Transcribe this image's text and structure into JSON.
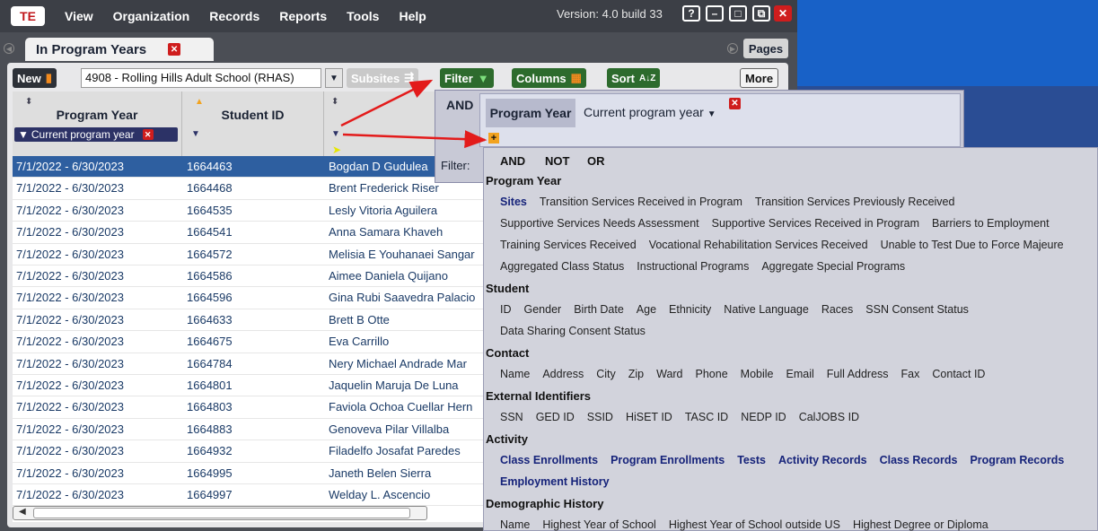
{
  "menu": {
    "logo": "TE",
    "items": [
      "View",
      "Organization",
      "Records",
      "Reports",
      "Tools",
      "Help"
    ],
    "version": "Version: 4.0 build 33",
    "window_buttons": [
      "?",
      "–",
      "□",
      "⧉",
      "✕"
    ]
  },
  "tab": {
    "label": "In Program Years",
    "close": "✕",
    "pages": "Pages"
  },
  "toolbar": {
    "new": "New",
    "school": "4908 - Rolling Hills Adult School (RHAS)",
    "subsites": "Subsites",
    "filter": "Filter",
    "columns": "Columns",
    "sort": "Sort",
    "sort_glyph": "A↓Z",
    "more": "More"
  },
  "grid": {
    "headers": [
      "Program Year",
      "Student ID",
      ""
    ],
    "filter_chip": "Current program year",
    "rows": [
      [
        "7/1/2022 - 6/30/2023",
        "1664463",
        "Bogdan D Gudulea"
      ],
      [
        "7/1/2022 - 6/30/2023",
        "1664468",
        "Brent Frederick Riser"
      ],
      [
        "7/1/2022 - 6/30/2023",
        "1664535",
        "Lesly Vitoria Aguilera"
      ],
      [
        "7/1/2022 - 6/30/2023",
        "1664541",
        "Anna Samara Khaveh"
      ],
      [
        "7/1/2022 - 6/30/2023",
        "1664572",
        "Melisia E Youhanaei Sangar"
      ],
      [
        "7/1/2022 - 6/30/2023",
        "1664586",
        "Aimee Daniela Quijano"
      ],
      [
        "7/1/2022 - 6/30/2023",
        "1664596",
        "Gina Rubi Saavedra Palacio"
      ],
      [
        "7/1/2022 - 6/30/2023",
        "1664633",
        "Brett B Otte"
      ],
      [
        "7/1/2022 - 6/30/2023",
        "1664675",
        "Eva Carrillo"
      ],
      [
        "7/1/2022 - 6/30/2023",
        "1664784",
        "Nery Michael Andrade Mar"
      ],
      [
        "7/1/2022 - 6/30/2023",
        "1664801",
        "Jaquelin Maruja De Luna"
      ],
      [
        "7/1/2022 - 6/30/2023",
        "1664803",
        "Faviola Ochoa Cuellar Hern"
      ],
      [
        "7/1/2022 - 6/30/2023",
        "1664883",
        "Genoveva Pilar Villalba"
      ],
      [
        "7/1/2022 - 6/30/2023",
        "1664932",
        "Filadelfo Josafat Paredes"
      ],
      [
        "7/1/2022 - 6/30/2023",
        "1664995",
        "Janeth Belen Sierra"
      ],
      [
        "7/1/2022 - 6/30/2023",
        "1664997",
        "Welday L. Ascencio"
      ]
    ]
  },
  "filter_panel": {
    "and": "AND",
    "chip": "Program Year",
    "value": "Current program year",
    "label": "Filter:"
  },
  "dropdown": {
    "ops": [
      "AND",
      "NOT",
      "OR"
    ],
    "sections": [
      {
        "title": "Program Year",
        "lines": [
          [
            "Sites",
            "Transition Services Received in Program",
            "Transition Services Previously Received"
          ],
          [
            "Supportive Services Needs Assessment",
            "Supportive Services Received in Program",
            "Barriers to Employment"
          ],
          [
            "Training Services Received",
            "Vocational Rehabilitation Services Received",
            "Unable to Test Due to Force Majeure"
          ],
          [
            "Aggregated Class Status",
            "Instructional Programs",
            "Aggregate Special Programs"
          ]
        ]
      },
      {
        "title": "Student",
        "lines": [
          [
            "ID",
            "Gender",
            "Birth Date",
            "Age",
            "Ethnicity",
            "Native Language",
            "Races",
            "SSN Consent Status"
          ],
          [
            "Data Sharing Consent Status"
          ]
        ]
      },
      {
        "title": "Contact",
        "lines": [
          [
            "Name",
            "Address",
            "City",
            "Zip",
            "Ward",
            "Phone",
            "Mobile",
            "Email",
            "Full Address",
            "Fax",
            "Contact ID"
          ]
        ]
      },
      {
        "title": "External Identifiers",
        "lines": [
          [
            "SSN",
            "GED ID",
            "SSID",
            "HiSET ID",
            "TASC ID",
            "NEDP ID",
            "CalJOBS ID"
          ]
        ]
      },
      {
        "title": "Activity",
        "lines": [
          [
            "Class Enrollments",
            "Program Enrollments",
            "Tests",
            "Activity Records",
            "Class Records",
            "Program Records"
          ],
          [
            "Employment History"
          ]
        ]
      },
      {
        "title": "Demographic History",
        "lines": [
          [
            "Name",
            "Highest Year of School",
            "Highest Year of School outside US",
            "Highest Degree or Diploma"
          ]
        ]
      }
    ]
  }
}
